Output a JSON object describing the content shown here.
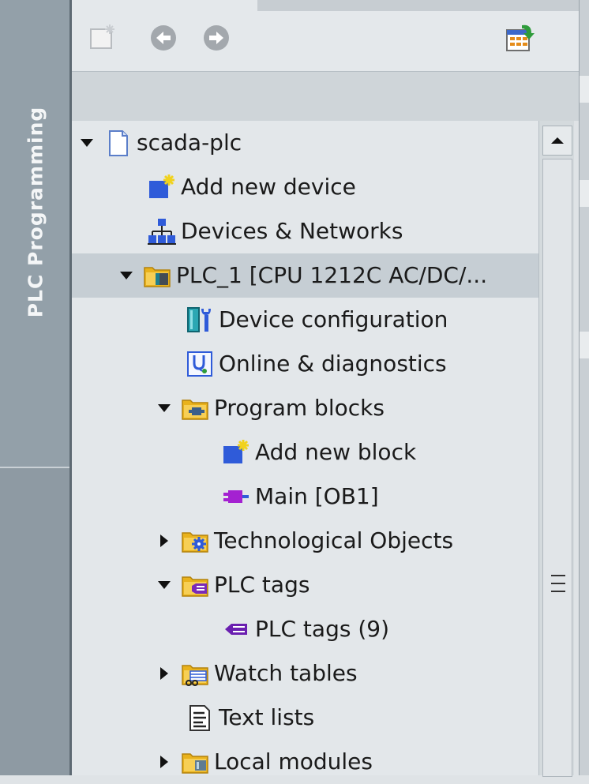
{
  "sidebar": {
    "label": "PLC Programming"
  },
  "toolbar": {
    "buttons": [
      {
        "name": "new-folder-button",
        "icon": "new-folder-icon"
      },
      {
        "name": "back-button",
        "icon": "back-arrow-icon"
      },
      {
        "name": "forward-button",
        "icon": "forward-arrow-icon"
      },
      {
        "name": "export-table-button",
        "icon": "table-export-icon"
      }
    ]
  },
  "tree": {
    "items": [
      {
        "label": "scada-plc",
        "expander": "expanded",
        "icon": "project-document-icon"
      },
      {
        "label": "Add new device",
        "expander": "none",
        "icon": "add-new-device-icon"
      },
      {
        "label": "Devices & Networks",
        "expander": "none",
        "icon": "network-icon"
      },
      {
        "label": "PLC_1 [CPU 1212C AC/DC/...",
        "expander": "expanded",
        "icon": "plc-folder-icon",
        "selected": true
      },
      {
        "label": "Device configuration",
        "expander": "none",
        "icon": "device-configuration-icon"
      },
      {
        "label": "Online & diagnostics",
        "expander": "none",
        "icon": "diagnostics-icon"
      },
      {
        "label": "Program blocks",
        "expander": "expanded",
        "icon": "program-blocks-folder-icon"
      },
      {
        "label": "Add new block",
        "expander": "none",
        "icon": "add-new-block-icon"
      },
      {
        "label": "Main [OB1]",
        "expander": "none",
        "icon": "organization-block-icon"
      },
      {
        "label": "Technological Objects",
        "expander": "collapsed",
        "icon": "technological-objects-folder-icon"
      },
      {
        "label": "PLC tags",
        "expander": "expanded",
        "icon": "plc-tags-folder-icon"
      },
      {
        "label": "PLC tags (9)",
        "expander": "none",
        "icon": "tag-table-icon"
      },
      {
        "label": "Watch tables",
        "expander": "collapsed",
        "icon": "watch-tables-folder-icon"
      },
      {
        "label": "Text lists",
        "expander": "none",
        "icon": "text-list-icon"
      },
      {
        "label": "Local modules",
        "expander": "collapsed",
        "icon": "local-modules-folder-icon"
      }
    ]
  },
  "colors": {
    "rail": "#93a0a9",
    "panel": "#e3e7ea",
    "selection": "#c6ced4",
    "folder": "#e9b21c",
    "accent_blue": "#2f5bd9"
  }
}
